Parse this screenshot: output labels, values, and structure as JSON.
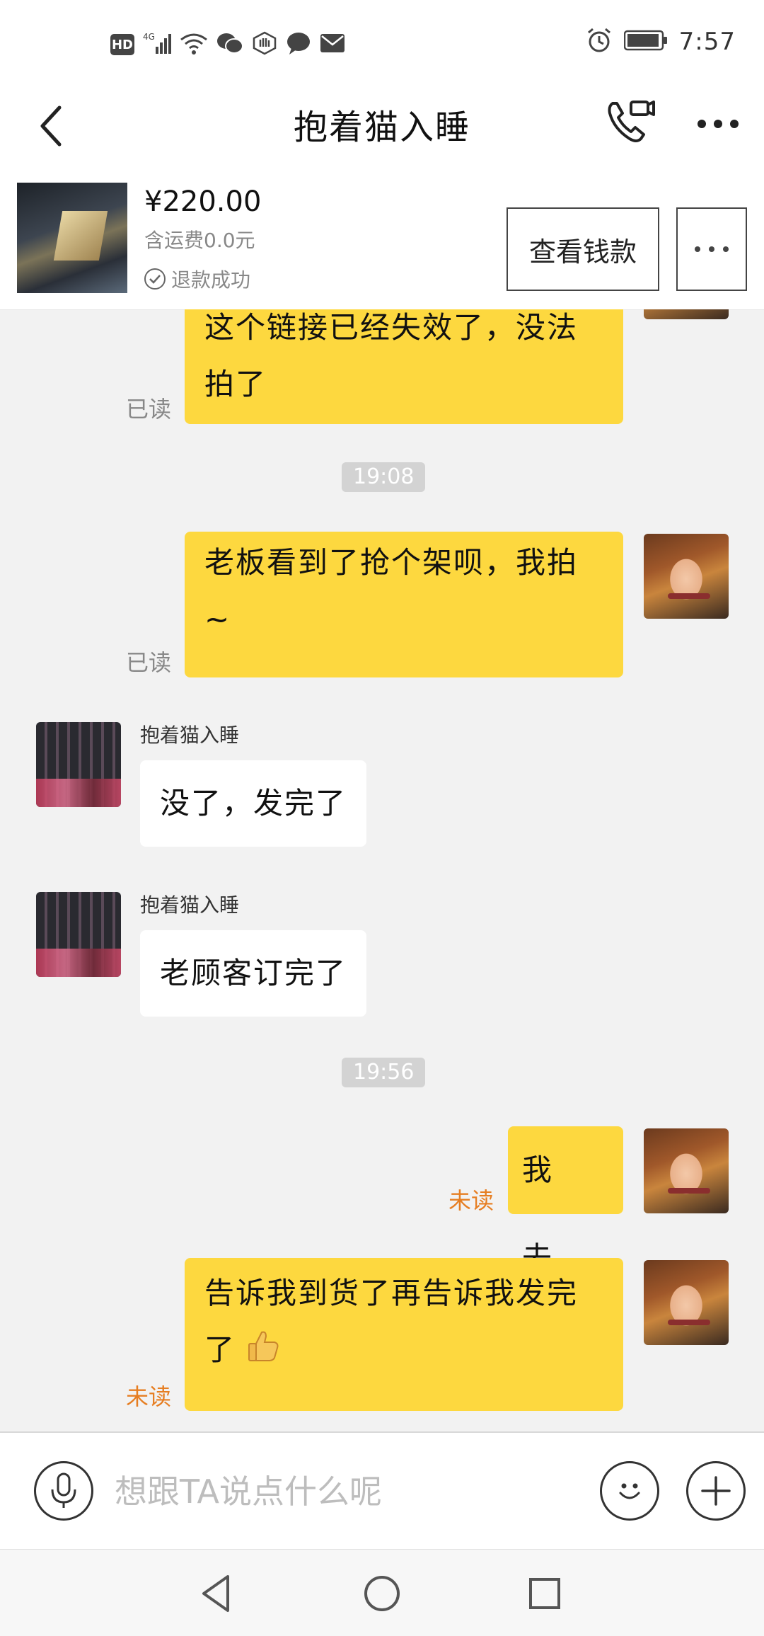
{
  "status_bar": {
    "hd_label": "HD",
    "network_label": "4G",
    "time": "7:57",
    "icons": [
      "signal-icon",
      "wifi-icon",
      "wechat-icon",
      "hand-icon",
      "message-icon",
      "mail-icon",
      "alarm-icon",
      "battery-icon"
    ]
  },
  "header": {
    "title": "抱着猫入睡"
  },
  "product": {
    "price": "¥220.00",
    "shipping": "含运费0.0元",
    "status": "退款成功",
    "view_button": "查看钱款"
  },
  "messages": [
    {
      "from": "me",
      "text_line1": "这个链接已经失效了，没法",
      "text_line2": "拍了",
      "read": "已读"
    },
    {
      "type": "timestamp",
      "text": "19:08"
    },
    {
      "from": "me",
      "text_line1": "老板看到了抢个架呗，我拍",
      "text_line2": "~",
      "read": "已读"
    },
    {
      "from": "them",
      "sender": "抱着猫入睡",
      "text": "没了，发完了"
    },
    {
      "from": "them",
      "sender": "抱着猫入睡",
      "text": "老顾客订完了"
    },
    {
      "type": "timestamp",
      "text": "19:56"
    },
    {
      "from": "me",
      "text": "我去…",
      "read": "未读"
    },
    {
      "from": "me",
      "text_line1": "告诉我到货了再告诉我发完",
      "text_line2": "了",
      "read": "未读"
    }
  ],
  "input": {
    "placeholder": "想跟TA说点什么呢"
  },
  "colors": {
    "my_bubble": "#fdd83f",
    "their_bubble": "#ffffff",
    "unread": "#e67e22",
    "background": "#f2f2f2"
  }
}
